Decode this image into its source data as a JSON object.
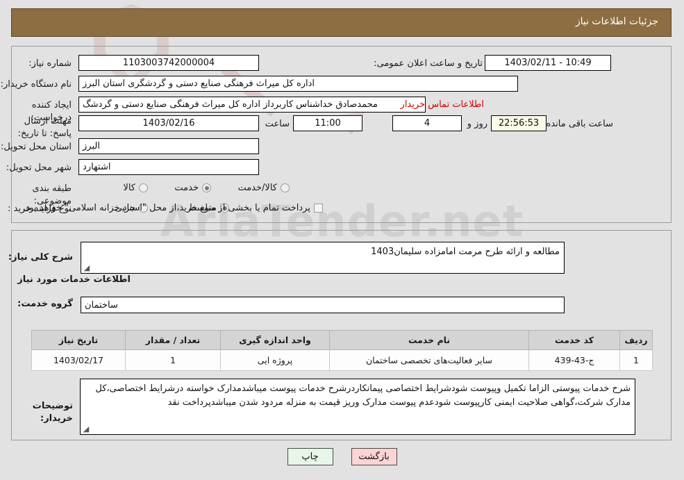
{
  "header": {
    "title": "جزئیات اطلاعات نیاز",
    "bg_color": "#8d6e43"
  },
  "form": {
    "need_number_label": "شماره نیاز:",
    "need_number_value": "1103003742000004",
    "public_announce_label": "تاریخ و ساعت اعلان عمومی:",
    "public_announce_value": "1403/02/11 - 10:49",
    "buyer_org_label": "نام دستگاه خریدار:",
    "buyer_org_value": "اداره کل میراث فرهنگی  صنایع دستی و گردشگری استان البرز",
    "creator_label": "ایجاد کننده درخواست:",
    "creator_value": "محمدصادق خداشناس  کاربرداز اداره کل میراث فرهنگی  صنایع دستی و گردشگ",
    "contact_link": "اطلاعات تماس خریدار",
    "deadline_label": "مهلت ارسال پاسخ: تا تاریخ:",
    "deadline_date": "1403/02/16",
    "deadline_hour_label": "ساعت",
    "deadline_hour_value": "11:00",
    "remaining_days_value": "4",
    "remaining_days_label": "روز و",
    "remaining_time_value": "22:56:53",
    "remaining_time_label": "ساعت باقی مانده",
    "province_label": "استان محل تحویل:",
    "province_value": "البرز",
    "city_label": "شهر محل تحویل:",
    "city_value": "اشتهارد",
    "category_label": "طبقه بندی موضوعی:",
    "category_options": [
      {
        "label": "کالا",
        "selected": false
      },
      {
        "label": "خدمت",
        "selected": true
      },
      {
        "label": "کالا/خدمت",
        "selected": false
      }
    ],
    "purchase_type_label": "نوع فرآیند خرید :",
    "purchase_type_options": [
      {
        "label": "جزیی",
        "selected": false
      },
      {
        "label": "متوسط",
        "selected": true
      }
    ],
    "treasury_checkbox_label": "پرداخت تمام یا بخشی از مبلغ خرید،از محل \"اسناد خزانه اسلامی\" خواهد بود.",
    "treasury_checked": false
  },
  "need_summary": {
    "label": "شرح کلی نیاز:",
    "value": "مطالعه  و ارائه طرح مرمت امامزاده سلیمان1403"
  },
  "services_section": {
    "heading": "اطلاعات خدمات مورد نیاز",
    "service_group_label": "گروه خدمت:",
    "service_group_value": "ساختمان"
  },
  "table": {
    "columns": [
      "ردیف",
      "کد خدمت",
      "نام خدمت",
      "واحد اندازه گیری",
      "تعداد / مقدار",
      "تاریخ نیاز"
    ],
    "rows": [
      {
        "row_no": "1",
        "service_code": "ج-43-439",
        "service_name": "سایر فعالیت‌های تخصصی ساختمان",
        "unit": "پروژه ایی",
        "quantity": "1",
        "need_date": "1403/02/17"
      }
    ]
  },
  "buyer_notes": {
    "label": "توضیحات خریدار:",
    "value": "شرح خدمات پیوستی الزاما تکمیل وپیوست شودشرایط اختصاصی پیمانکاردرشرح خدمات پیوست میباشدمدارک خواسته درشرایط اختصاصی،کل مدارک شرکت،گواهی صلاحیت ایمنی کارپیوست شودعدم پیوست مدارک وریز قیمت به منزله مردود شدن میباشدپرداخت نقد"
  },
  "footer": {
    "print_label": "چاپ",
    "back_label": "بازگشت"
  },
  "watermark": {
    "text": "AriaTender.net"
  }
}
